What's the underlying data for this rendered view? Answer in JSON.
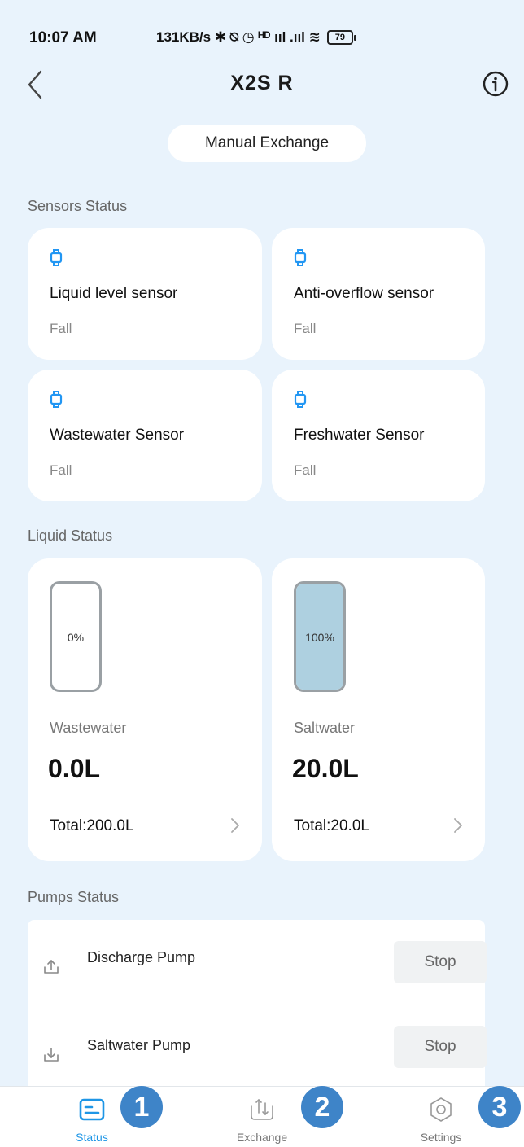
{
  "status_bar": {
    "time": "10:07 AM",
    "indicators": "131KB/s ✱ ⍉ ◷ ᴴᴰ ııl .ııl ≋",
    "battery": "79"
  },
  "header": {
    "title": "X2S R",
    "back_icon": "chevron-left-icon",
    "info_icon": "info-circle-icon"
  },
  "manual_exchange_label": "Manual Exchange",
  "sensors": {
    "section_title": "Sensors Status",
    "items": [
      {
        "name": "Liquid level sensor",
        "state": "Fall"
      },
      {
        "name": "Anti-overflow sensor",
        "state": "Fall"
      },
      {
        "name": "Wastewater Sensor",
        "state": "Fall"
      },
      {
        "name": "Freshwater Sensor",
        "state": "Fall"
      }
    ]
  },
  "liquid": {
    "section_title": "Liquid Status",
    "items": [
      {
        "percent_label": "0%",
        "fill_fraction": 0.0,
        "name": "Wastewater",
        "volume": "0.0L",
        "total": "Total:200.0L"
      },
      {
        "percent_label": "100%",
        "fill_fraction": 1.0,
        "name": "Saltwater",
        "volume": "20.0L",
        "total": "Total:20.0L"
      }
    ]
  },
  "pumps": {
    "section_title": "Pumps Status",
    "items": [
      {
        "name": "Discharge Pump",
        "button": "Stop",
        "icon": "arrow-up-icon"
      },
      {
        "name": "Saltwater Pump",
        "button": "Stop",
        "icon": "arrow-down-icon"
      }
    ]
  },
  "nav": {
    "items": [
      {
        "label": "Status",
        "active": true,
        "badge": "1"
      },
      {
        "label": "Exchange",
        "active": false,
        "badge": "2"
      },
      {
        "label": "Settings",
        "active": false,
        "badge": "3"
      }
    ]
  },
  "colors": {
    "background": "#e9f3fc",
    "accent": "#1e96e6",
    "water_fill": "#aed0e0",
    "badge": "#3e84c8"
  }
}
